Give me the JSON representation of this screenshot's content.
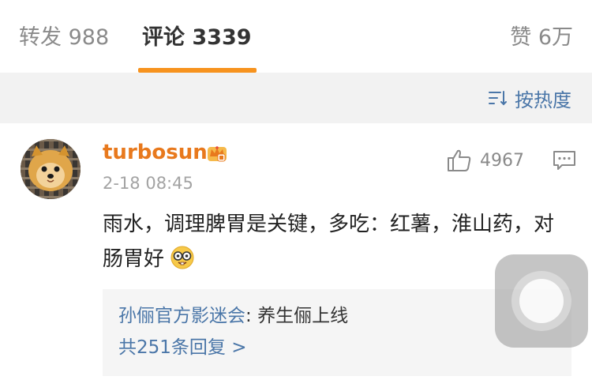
{
  "tabs": {
    "repost": "转发 988",
    "comments": "评论 3339",
    "likes": "赞 6万"
  },
  "sort": {
    "label": "按热度",
    "icon": "sort-lines-icon"
  },
  "comment": {
    "username": "turbosun",
    "badge_icon": "crown-vip-icon",
    "timestamp": "2-18 08:45",
    "like_count": "4967",
    "text_main": "雨水，调理脾胃是关键，多吃：红薯，淮山药，对肠胃好",
    "emoji_icon": "nerd-face-emoji",
    "replies": {
      "author": "孙俪官方影迷会",
      "colon": ": ",
      "text": "养生俪上线",
      "more": "共251条回复 >"
    }
  },
  "colors": {
    "accent": "#f7931e",
    "username": "#e8791d",
    "link": "#4a76a8"
  }
}
